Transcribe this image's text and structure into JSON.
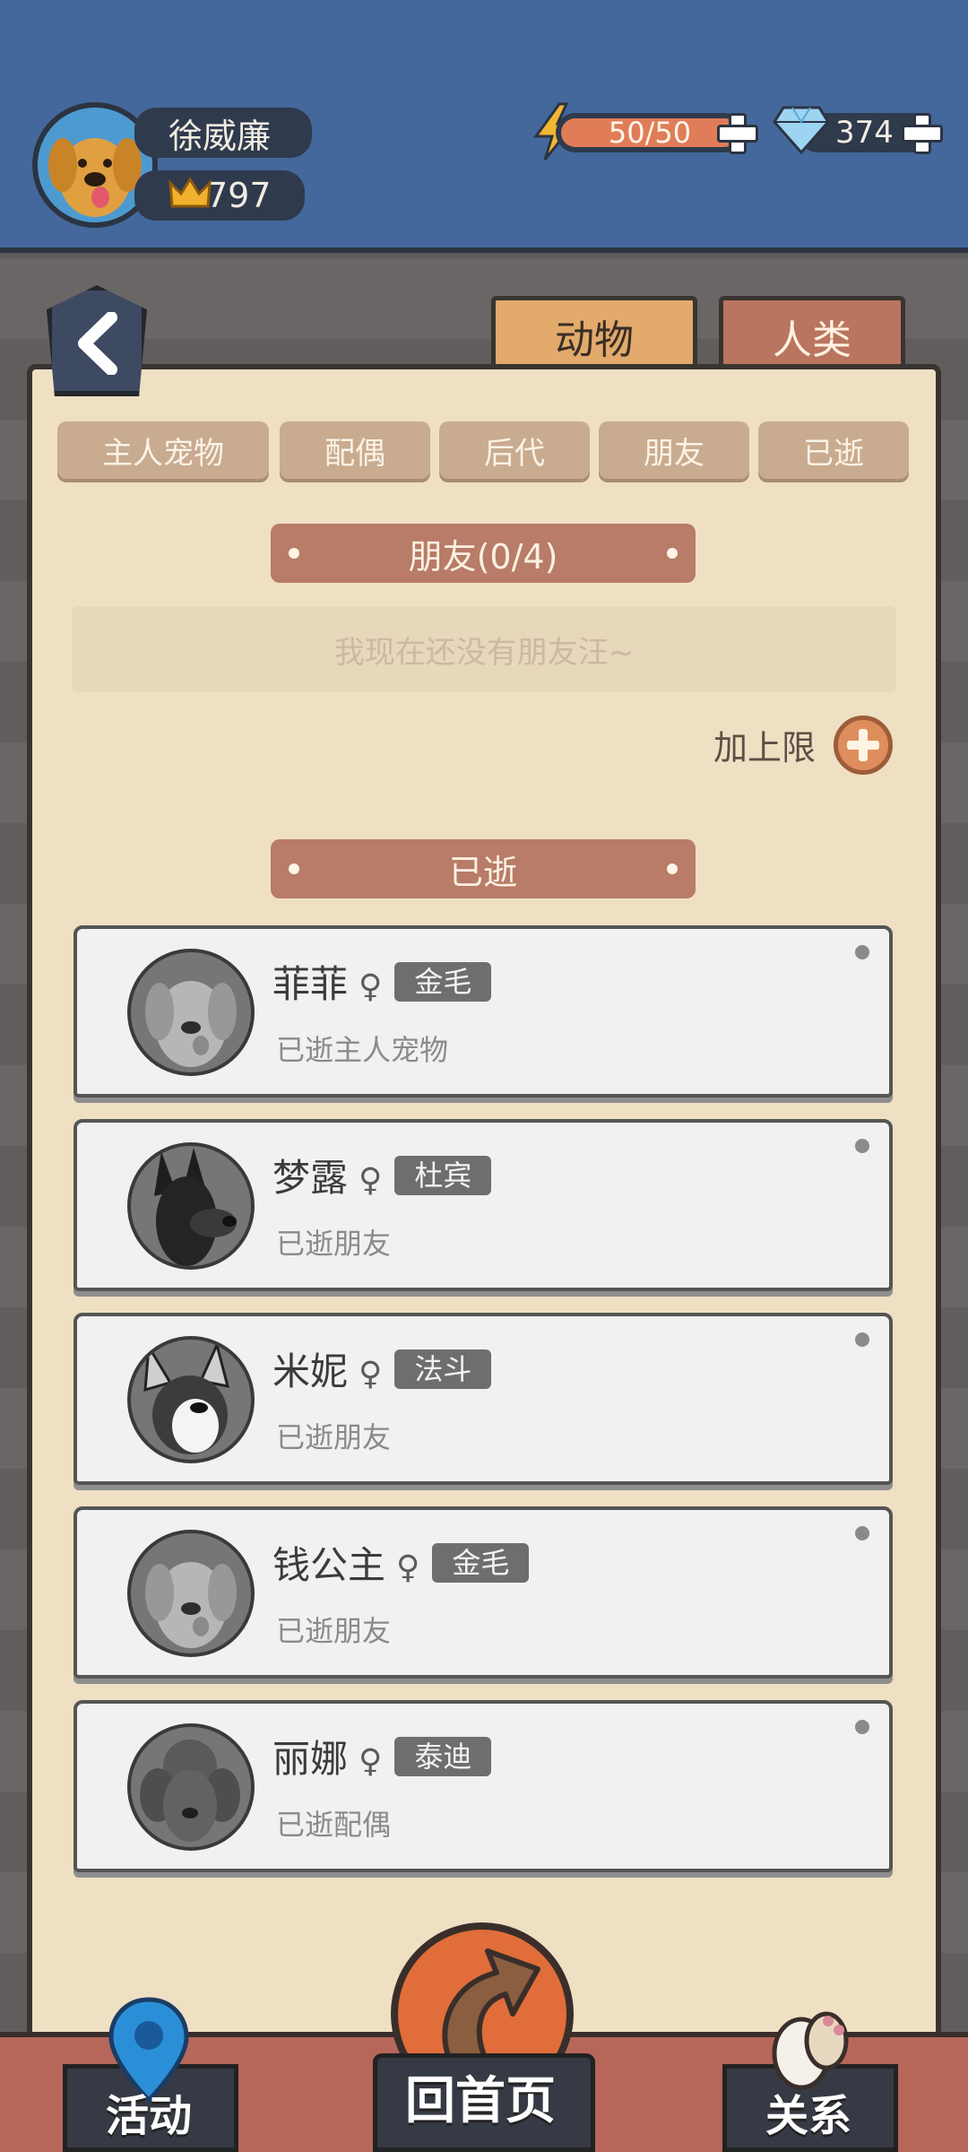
{
  "header": {
    "player_name": "徐威廉",
    "crown_count": "797",
    "energy_text": "50/50",
    "energy_fraction": 1.0,
    "gem_count": "374",
    "icons": [
      "dog-avatar-icon",
      "crown-icon",
      "lightning-icon",
      "diamond-icon",
      "plus-icon"
    ]
  },
  "tabs": {
    "animal": "动物",
    "human": "人类"
  },
  "filters": [
    "主人宠物",
    "配偶",
    "后代",
    "朋友",
    "已逝"
  ],
  "friends_section": {
    "title": "朋友(0/4)",
    "empty_text": "我现在还没有朋友汪~",
    "limit_label": "加上限"
  },
  "deceased_section": {
    "title": "已逝",
    "entries": [
      {
        "name": "菲菲",
        "sex": "♀",
        "breed": "金毛",
        "status": "已逝主人宠物"
      },
      {
        "name": "梦露",
        "sex": "♀",
        "breed": "杜宾",
        "status": "已逝朋友"
      },
      {
        "name": "米妮",
        "sex": "♀",
        "breed": "法斗",
        "status": "已逝朋友"
      },
      {
        "name": "钱公主",
        "sex": "♀",
        "breed": "金毛",
        "status": "已逝朋友"
      },
      {
        "name": "丽娜",
        "sex": "♀",
        "breed": "泰迪",
        "status": "已逝配偶"
      }
    ]
  },
  "bottom_nav": {
    "activity": "活动",
    "home": "回首页",
    "relations": "关系"
  },
  "colors": {
    "header_bg": "#44689c",
    "panel_bg": "#efe0c3",
    "ribbon": "#b87c68",
    "energy": "#e07d58",
    "home_button": "#e06d3a"
  }
}
